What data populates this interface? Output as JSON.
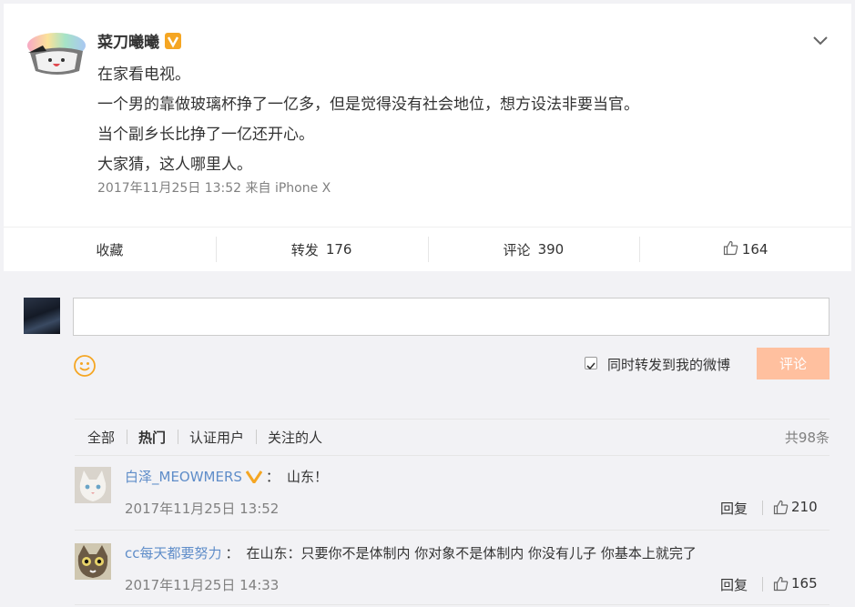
{
  "post": {
    "author": "菜刀曦曦",
    "verified_badge": "V",
    "menu_icon": "chevron-down-icon",
    "lines": [
      "在家看电视。",
      "一个男的靠做玻璃杯挣了一亿多，但是觉得没有社会地位，想方设法非要当官。",
      "当个副乡长比挣了一亿还开心。",
      "大家猜，这人哪里人。"
    ],
    "meta": "2017年11月25日 13:52 来自 iPhone X"
  },
  "actions": {
    "collect": "收藏",
    "forward_label": "转发",
    "forward_count": "176",
    "comment_label": "评论",
    "comment_count": "390",
    "like_icon": "thumbs-up-icon",
    "like_count": "164"
  },
  "composer": {
    "input_value": "",
    "emoji_icon": "smiley-icon",
    "forward_checked": true,
    "forward_label": "同时转发到我的微博",
    "submit_label": "评论",
    "submit_color": "#ffc09f"
  },
  "filters": {
    "tabs": [
      "全部",
      "热门",
      "认证用户",
      "关注的人"
    ],
    "active": "热门",
    "total": "共98条"
  },
  "comments": [
    {
      "name": "白泽_MEOWMERS",
      "verified": true,
      "text": "山东！",
      "time": "2017年11月25日 13:52",
      "reply": "回复",
      "likes": "210"
    },
    {
      "name": "cc每天都要努力",
      "verified": false,
      "text": "在山东：只要你不是体制内 你对象不是体制内 你没有儿子 你基本上就完了",
      "time": "2017年11月25日 14:33",
      "reply": "回复",
      "likes": "165"
    }
  ],
  "colors": {
    "link": "#5f8dc9",
    "badge": "#f5a623",
    "meta": "#808080"
  }
}
